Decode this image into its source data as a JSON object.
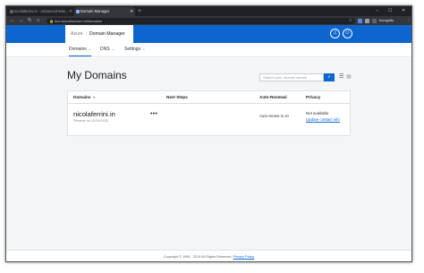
{
  "browser": {
    "tabs": [
      {
        "title": "nicolaferrini.in - Advanced Man...",
        "favicon_color": "#5f6368"
      },
      {
        "title": "Domain Manager",
        "favicon_color": "#8ab4f8"
      }
    ],
    "new_tab": "+",
    "window_controls": [
      "–",
      "☐",
      "✕"
    ],
    "address": "dcc.secureserver.net/domains",
    "profile": "Incognito"
  },
  "header": {
    "brand": "Azure",
    "separator": "|",
    "app_name": "Domain Manager"
  },
  "subnav": [
    {
      "label": "Domains"
    },
    {
      "label": "DNS"
    },
    {
      "label": "Settings"
    }
  ],
  "main": {
    "title": "My Domains",
    "search_placeholder": "Search your domain names"
  },
  "table": {
    "columns": [
      "Domains",
      "Next Steps",
      "Auto-Renewal",
      "Privacy"
    ],
    "rows": [
      {
        "domain": "nicolaferrini.in",
        "renews": "Renews on 12/19/2020",
        "next_steps": "•••",
        "auto_renewal": "Auto-renew is on",
        "privacy_status": "Not available",
        "privacy_action": "Update contact info"
      }
    ]
  },
  "footer": {
    "copyright": "Copyright © 1999 - 2019 All Rights Reserved.",
    "privacy_link": "Privacy Policy"
  },
  "colors": {
    "brand_blue": "#0d66d0",
    "tab_strip": "#202124",
    "toolbar": "#35363a"
  }
}
